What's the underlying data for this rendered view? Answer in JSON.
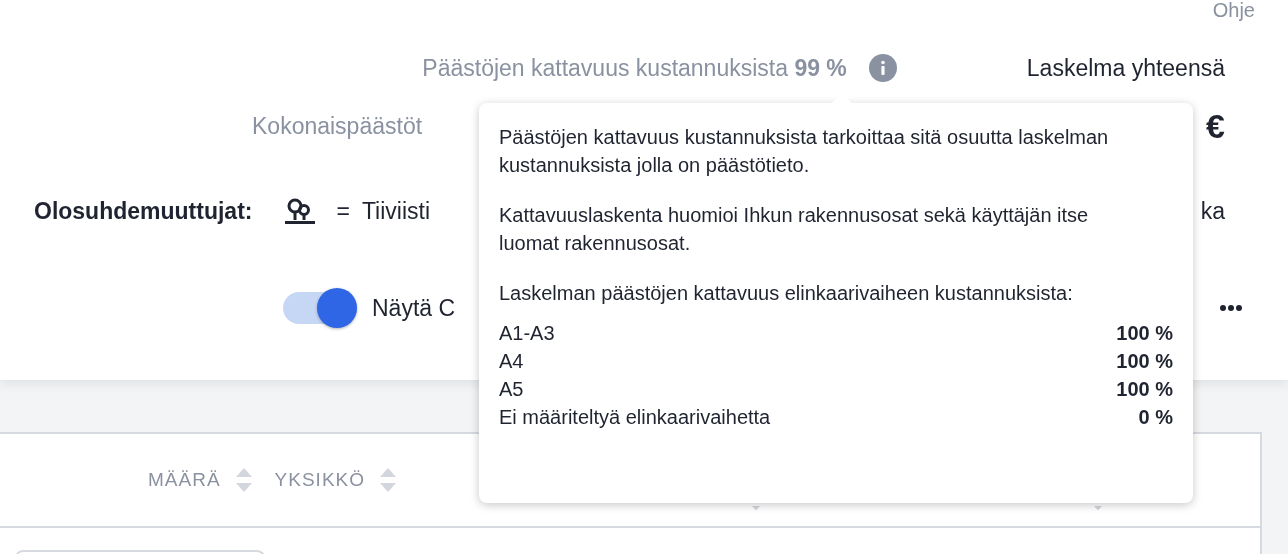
{
  "help_link": "Ohje",
  "summary": {
    "coverage_label": "Päästöjen kattavuus kustannuksista **99 %**",
    "total_label": "Laskelma yhteensä",
    "emissions_label": "Kokonaispäästöt",
    "currency": "€"
  },
  "conditions": {
    "label": "Olosuhdemuuttujat:",
    "symbol": "=",
    "text": "Tiiviisti",
    "trailing_text": "ka"
  },
  "toggle": {
    "label": "Näytä C",
    "on": true
  },
  "table": {
    "columns": [
      {
        "label": "MÄÄRÄ"
      },
      {
        "label": "YKSIKKÖ"
      }
    ]
  },
  "tooltip": {
    "paragraphs": [
      "Päästöjen kattavuus kustannuksista tarkoittaa sitä osuutta laskelman kustannuksista jolla on päästötieto.",
      "Kattavuuslaskenta huomioi Ihkun rakennusosat sekä käyttäjän itse luomat rakennusosat.",
      "Laskelman päästöjen kattavuus elinkaarivaiheen kustannuksista:"
    ],
    "rows": [
      {
        "label": "A1-A3",
        "value": "100 %"
      },
      {
        "label": "A4",
        "value": "100 %"
      },
      {
        "label": "A5",
        "value": "100 %"
      },
      {
        "label": "Ei määriteltyä elinkaarivaihetta",
        "value": "0 %"
      }
    ]
  }
}
